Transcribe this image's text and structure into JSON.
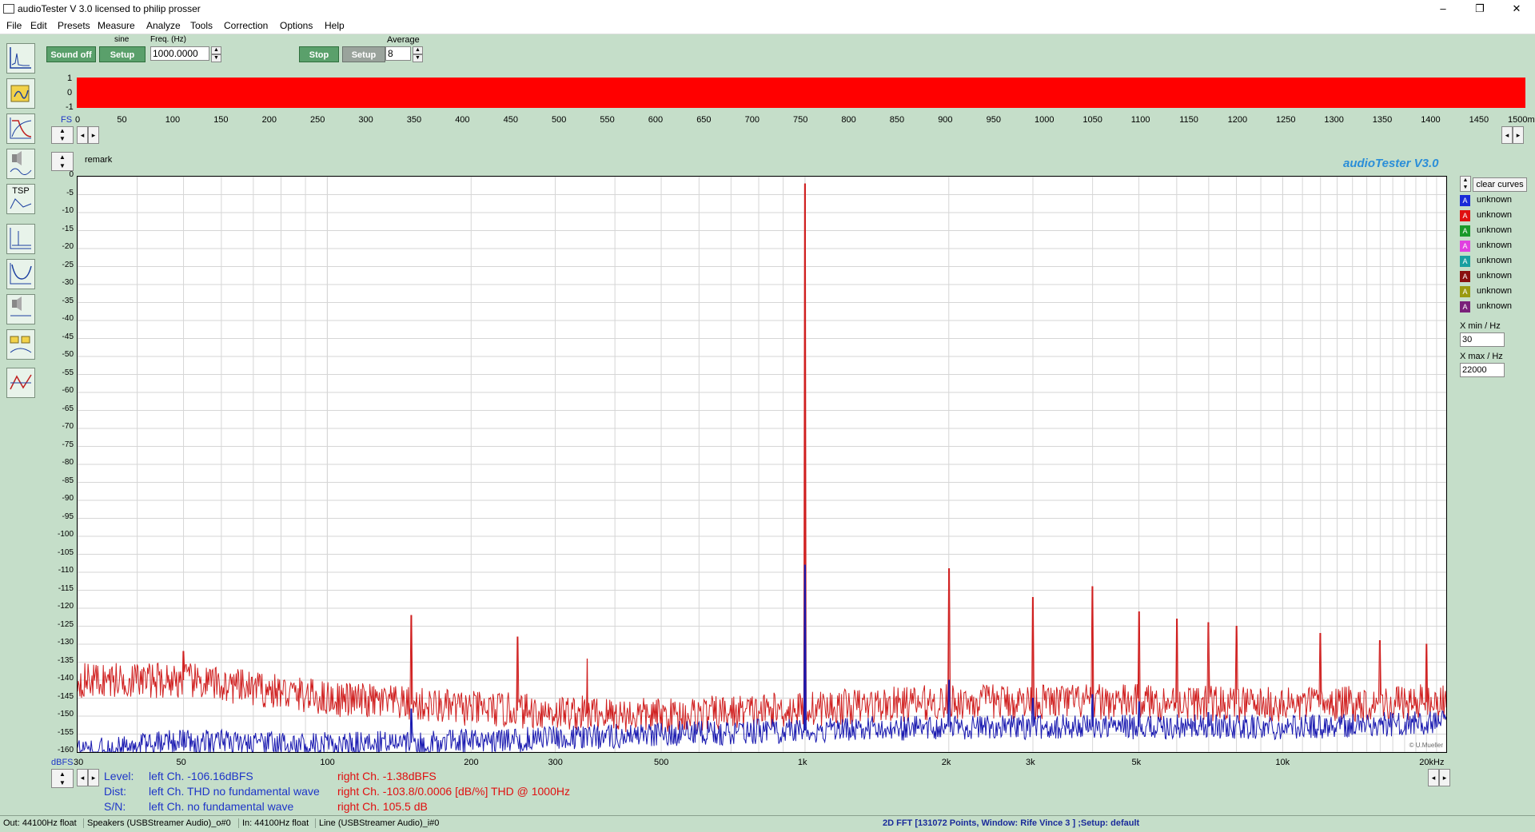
{
  "window": {
    "title": "audioTester  V 3.0   licensed to philip prosser",
    "minimize": "–",
    "restore": "❐",
    "close": "✕"
  },
  "menu": [
    "File",
    "Edit",
    "Presets",
    "Measure",
    "Analyze",
    "Tools",
    "Correction",
    "Options",
    "Help"
  ],
  "generator": {
    "sound_label": "Sound off",
    "type_label": "sine",
    "setup_label": "Setup",
    "freq_label": "Freq. (Hz)",
    "freq_value": "1000.0000"
  },
  "analyzer": {
    "stop_label": "Stop",
    "setup_label": "Setup",
    "average_label": "Average",
    "average_value": "8"
  },
  "waveform": {
    "fs_label": "FS",
    "y_ticks": [
      "1",
      "0",
      "-1"
    ],
    "x_ticks": [
      "0",
      "50",
      "100",
      "150",
      "200",
      "250",
      "300",
      "350",
      "400",
      "450",
      "500",
      "550",
      "600",
      "650",
      "700",
      "750",
      "800",
      "850",
      "900",
      "950",
      "1000",
      "1050",
      "1150",
      "1200",
      "1250",
      "1300",
      "1350",
      "1400",
      "1450",
      "1500m"
    ],
    "x_ticks_full": [
      "0",
      "50",
      "100",
      "150",
      "200",
      "250",
      "300",
      "350",
      "400",
      "450",
      "500",
      "550",
      "600",
      "650",
      "700",
      "750",
      "800",
      "850",
      "900",
      "950",
      "1000",
      "1050",
      "1100",
      "1150",
      "1200",
      "1250",
      "1300",
      "1350",
      "1400",
      "1450"
    ],
    "x_end": "1500m",
    "color": "#ff0000"
  },
  "graph": {
    "remark": "remark",
    "brand": "audioTester  V3.0",
    "copyright": "© U.Mueller",
    "y_unit": "dBFS",
    "x_unit": "20kHz"
  },
  "chart_data": {
    "type": "line",
    "title": "",
    "xlabel": "",
    "ylabel": "dBFS",
    "x_scale": "log",
    "xlim": [
      30,
      22000
    ],
    "ylim": [
      -160,
      0
    ],
    "x_ticks": [
      {
        "value": 30,
        "label": "30"
      },
      {
        "value": 50,
        "label": "50"
      },
      {
        "value": 100,
        "label": "100"
      },
      {
        "value": 200,
        "label": "200"
      },
      {
        "value": 300,
        "label": "300"
      },
      {
        "value": 500,
        "label": "500"
      },
      {
        "value": 1000,
        "label": "1k"
      },
      {
        "value": 2000,
        "label": "2k"
      },
      {
        "value": 3000,
        "label": "3k"
      },
      {
        "value": 5000,
        "label": "5k"
      },
      {
        "value": 10000,
        "label": "10k"
      },
      {
        "value": 20000,
        "label": "20kHz"
      }
    ],
    "y_ticks": [
      0,
      -5,
      -10,
      -15,
      -20,
      -25,
      -30,
      -35,
      -40,
      -45,
      -50,
      -55,
      -60,
      -65,
      -70,
      -75,
      -80,
      -85,
      -90,
      -95,
      -100,
      -105,
      -110,
      -115,
      -120,
      -125,
      -130,
      -135,
      -140,
      -145,
      -150,
      -155,
      -160
    ],
    "grid": true,
    "series": [
      {
        "color": "#d02020",
        "noise_floor": [
          [
            30,
            -140
          ],
          [
            50,
            -140
          ],
          [
            100,
            -145
          ],
          [
            200,
            -148
          ],
          [
            500,
            -150
          ],
          [
            1000,
            -148
          ],
          [
            2000,
            -146
          ],
          [
            5000,
            -146
          ],
          [
            10000,
            -147
          ],
          [
            22000,
            -146
          ]
        ],
        "peaks": [
          [
            1000,
            -2
          ],
          [
            2000,
            -109
          ],
          [
            3000,
            -117
          ],
          [
            4000,
            -114
          ],
          [
            5000,
            -121
          ],
          [
            6000,
            -123
          ],
          [
            7000,
            -124
          ],
          [
            8000,
            -125
          ],
          [
            12000,
            -127
          ],
          [
            16000,
            -129
          ],
          [
            150,
            -122
          ],
          [
            250,
            -128
          ],
          [
            50,
            -132
          ],
          [
            350,
            -134
          ],
          [
            20000,
            -130
          ]
        ]
      },
      {
        "color": "#1a1ab0",
        "noise_floor": [
          [
            30,
            -160
          ],
          [
            50,
            -157
          ],
          [
            100,
            -158
          ],
          [
            200,
            -157
          ],
          [
            500,
            -155
          ],
          [
            1000,
            -154
          ],
          [
            2000,
            -153
          ],
          [
            5000,
            -153
          ],
          [
            10000,
            -153
          ],
          [
            22000,
            -152
          ]
        ],
        "peaks": [
          [
            1000,
            -108
          ],
          [
            150,
            -148
          ],
          [
            2000,
            -140
          ],
          [
            3000,
            -145
          ],
          [
            4000,
            -144
          ],
          [
            5000,
            -146
          ],
          [
            7000,
            -149
          ]
        ]
      }
    ]
  },
  "legend": {
    "clear_label": "clear curves",
    "items": [
      {
        "icon": "A",
        "label": "unknown",
        "color": "#1a2bd8"
      },
      {
        "icon": "A",
        "label": "unknown",
        "color": "#e01010"
      },
      {
        "icon": "A",
        "label": "unknown",
        "color": "#1a9a2a"
      },
      {
        "icon": "A",
        "label": "unknown",
        "color": "#e040e0"
      },
      {
        "icon": "A",
        "label": "unknown",
        "color": "#18a0a0"
      },
      {
        "icon": "A",
        "label": "unknown",
        "color": "#8a1010"
      },
      {
        "icon": "A",
        "label": "unknown",
        "color": "#9a9a10"
      },
      {
        "icon": "A",
        "label": "unknown",
        "color": "#7a207a"
      }
    ],
    "xmin_label": "X min / Hz",
    "xmin_value": "30",
    "xmax_label": "X max / Hz",
    "xmax_value": "22000"
  },
  "readout": {
    "level_label": "Level:",
    "dist_label": "Dist:",
    "sn_label": "S/N:",
    "level_left": "left Ch. -106.16dBFS",
    "level_right": "right Ch. -1.38dBFS",
    "dist_left": "left Ch. THD no fundamental wave",
    "dist_right": "right Ch. -103.8/0.0006 [dB/%] THD @ 1000Hz",
    "sn_left": "left Ch.  no fundamental wave",
    "sn_right": "right Ch. 105.5 dB"
  },
  "status": {
    "out": "Out: 44100Hz float",
    "speakers": "Speakers (USBStreamer Audio)_o#0",
    "in": "In: 44100Hz float",
    "line": "Line (USBStreamer Audio)_i#0",
    "fft": "2D FFT [131072 Points, Window: Rife Vince 3 ]  ;Setup:  default"
  },
  "tools": [
    "fft-view-icon",
    "generator-icon",
    "filter-icon",
    "speaker-icon",
    "tsp-icon",
    "impulse-icon",
    "frequency-response-icon",
    "speaker-measure-icon",
    "crossover-icon",
    "step-response-icon"
  ],
  "tsp_text": "TSP"
}
